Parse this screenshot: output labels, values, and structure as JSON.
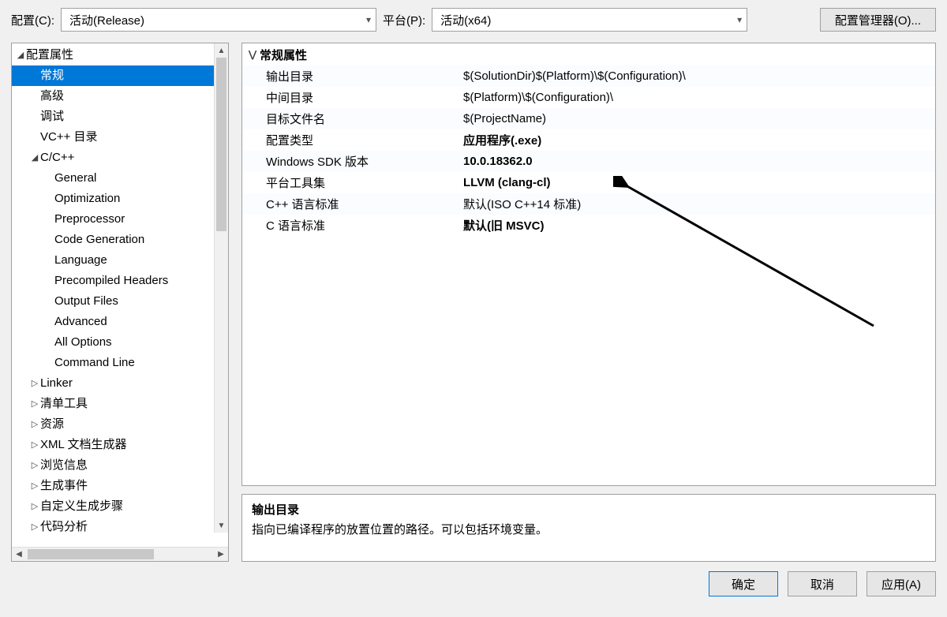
{
  "top": {
    "config_label": "配置(C):",
    "config_value": "活动(Release)",
    "platform_label": "平台(P):",
    "platform_value": "活动(x64)",
    "manager_btn": "配置管理器(O)..."
  },
  "tree": [
    {
      "indent": 0,
      "expander": "◢",
      "label": "配置属性"
    },
    {
      "indent": 1,
      "expander": "",
      "label": "常规",
      "selected": true
    },
    {
      "indent": 1,
      "expander": "",
      "label": "高级"
    },
    {
      "indent": 1,
      "expander": "",
      "label": "调试"
    },
    {
      "indent": 1,
      "expander": "",
      "label": "VC++ 目录"
    },
    {
      "indent": 1,
      "expander": "◢",
      "label": "C/C++"
    },
    {
      "indent": 2,
      "expander": "",
      "label": "General"
    },
    {
      "indent": 2,
      "expander": "",
      "label": "Optimization"
    },
    {
      "indent": 2,
      "expander": "",
      "label": "Preprocessor"
    },
    {
      "indent": 2,
      "expander": "",
      "label": "Code Generation"
    },
    {
      "indent": 2,
      "expander": "",
      "label": "Language"
    },
    {
      "indent": 2,
      "expander": "",
      "label": "Precompiled Headers"
    },
    {
      "indent": 2,
      "expander": "",
      "label": "Output Files"
    },
    {
      "indent": 2,
      "expander": "",
      "label": "Advanced"
    },
    {
      "indent": 2,
      "expander": "",
      "label": "All Options"
    },
    {
      "indent": 2,
      "expander": "",
      "label": "Command Line"
    },
    {
      "indent": 1,
      "expander": "▷",
      "label": "Linker"
    },
    {
      "indent": 1,
      "expander": "▷",
      "label": "清单工具"
    },
    {
      "indent": 1,
      "expander": "▷",
      "label": "资源"
    },
    {
      "indent": 1,
      "expander": "▷",
      "label": "XML 文档生成器"
    },
    {
      "indent": 1,
      "expander": "▷",
      "label": "浏览信息"
    },
    {
      "indent": 1,
      "expander": "▷",
      "label": "生成事件"
    },
    {
      "indent": 1,
      "expander": "▷",
      "label": "自定义生成步骤"
    },
    {
      "indent": 1,
      "expander": "▷",
      "label": "代码分析"
    }
  ],
  "props": {
    "header": "常规属性",
    "rows": [
      {
        "key": "输出目录",
        "val": "$(SolutionDir)$(Platform)\\$(Configuration)\\",
        "bold": false
      },
      {
        "key": "中间目录",
        "val": "$(Platform)\\$(Configuration)\\",
        "bold": false
      },
      {
        "key": "目标文件名",
        "val": "$(ProjectName)",
        "bold": false
      },
      {
        "key": "配置类型",
        "val": "应用程序(.exe)",
        "bold": true
      },
      {
        "key": "Windows SDK 版本",
        "val": "10.0.18362.0",
        "bold": true
      },
      {
        "key": "平台工具集",
        "val": "LLVM (clang-cl)",
        "bold": true
      },
      {
        "key": "C++ 语言标准",
        "val": "默认(ISO C++14 标准)",
        "bold": false
      },
      {
        "key": "C 语言标准",
        "val": "默认(旧 MSVC)",
        "bold": true
      }
    ]
  },
  "desc": {
    "title": "输出目录",
    "body": "指向已编译程序的放置位置的路径。可以包括环境变量。"
  },
  "footer": {
    "ok": "确定",
    "cancel": "取消",
    "apply": "应用(A)"
  }
}
